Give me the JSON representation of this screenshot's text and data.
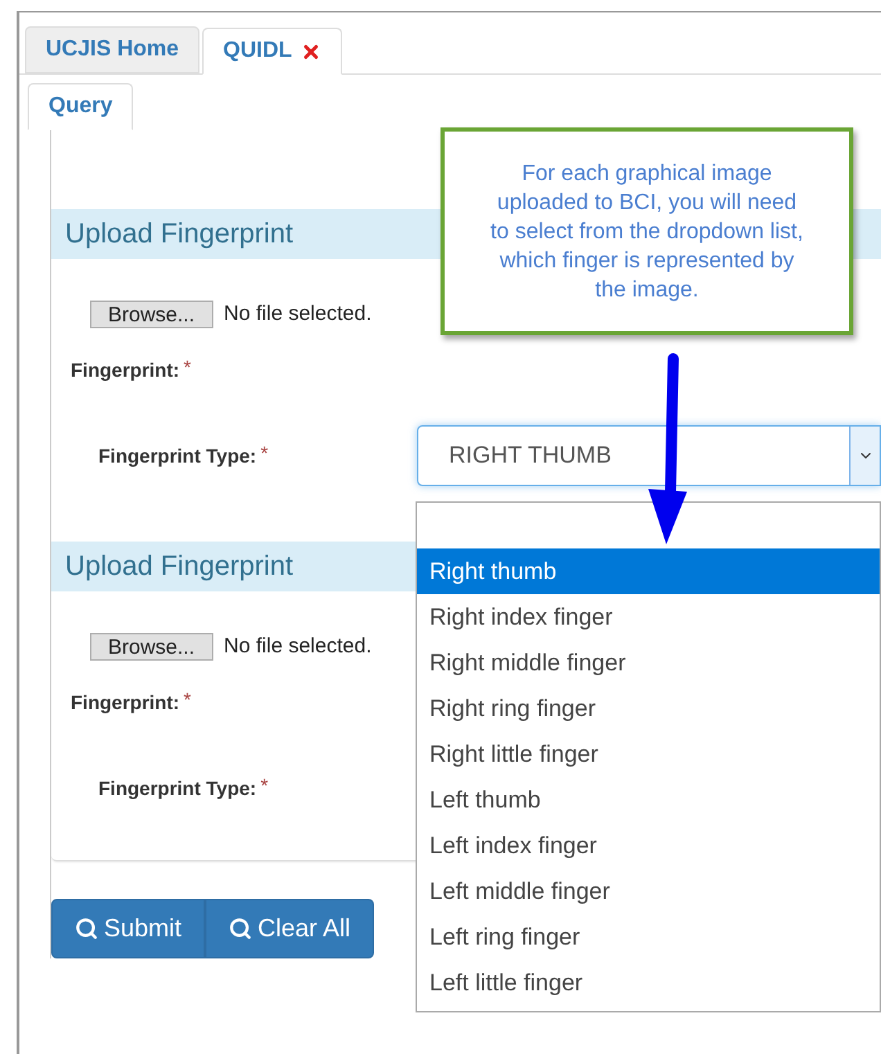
{
  "tabs": [
    {
      "label": "UCJIS Home",
      "selected": false,
      "closable": false
    },
    {
      "label": "QUIDL",
      "selected": true,
      "closable": true
    }
  ],
  "subtabs": [
    {
      "label": "Query",
      "selected": true
    }
  ],
  "sections": [
    {
      "title": "Upload Fingerprint",
      "browse_button": "Browse...",
      "file_status": "No file selected.",
      "fingerprint_label": "Fingerprint:",
      "type_label": "Fingerprint Type:",
      "required_mark": "*",
      "select_value": "RIGHT THUMB"
    },
    {
      "title": "Upload Fingerprint",
      "browse_button": "Browse...",
      "file_status": "No file selected.",
      "fingerprint_label": "Fingerprint:",
      "type_label": "Fingerprint Type:",
      "required_mark": "*"
    }
  ],
  "dropdown": {
    "options": [
      {
        "label": "Right thumb",
        "selected": true
      },
      {
        "label": "Right index finger",
        "selected": false
      },
      {
        "label": "Right middle finger",
        "selected": false
      },
      {
        "label": "Right ring finger",
        "selected": false
      },
      {
        "label": "Right little finger",
        "selected": false
      },
      {
        "label": "Left thumb",
        "selected": false
      },
      {
        "label": "Left index finger",
        "selected": false
      },
      {
        "label": "Left middle finger",
        "selected": false
      },
      {
        "label": "Left ring finger",
        "selected": false
      },
      {
        "label": "Left little finger",
        "selected": false
      }
    ]
  },
  "buttons": [
    "Submit",
    "Clear All"
  ],
  "callout": {
    "text": "For each graphical image uploaded to BCI, you will need to select from the dropdown list, which finger is represented by the image."
  }
}
